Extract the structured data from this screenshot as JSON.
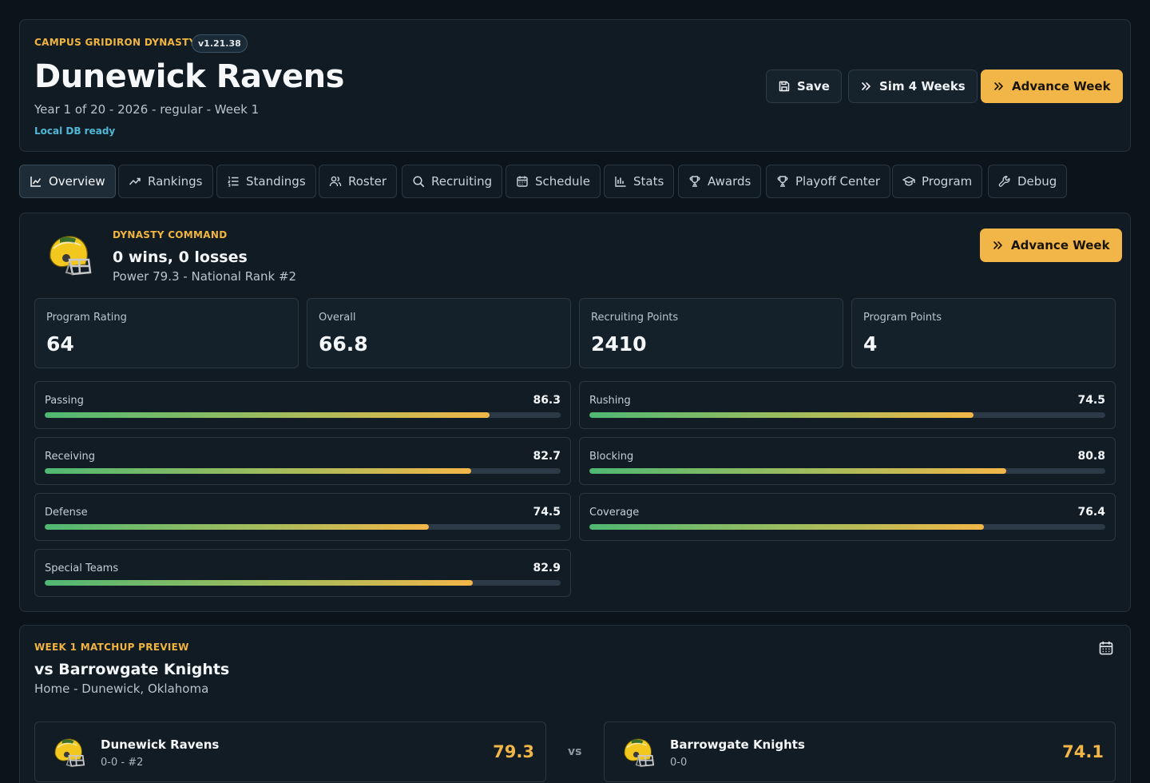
{
  "header": {
    "eyebrow": "CAMPUS GRIDIRON DYNASTY",
    "version": "v1.21.38",
    "title": "Dunewick Ravens",
    "subtitle": "Year 1 of 20 - 2026 - regular - Week 1",
    "db_status": "Local DB ready",
    "buttons": {
      "save": "Save",
      "sim": "Sim 4 Weeks",
      "advance": "Advance Week"
    }
  },
  "tabs": [
    {
      "label": "Overview",
      "icon": "chart-line-icon",
      "active": true
    },
    {
      "label": "Rankings",
      "icon": "trending-up-icon"
    },
    {
      "label": "Standings",
      "icon": "list-ordered-icon"
    },
    {
      "label": "Roster",
      "icon": "users-icon"
    },
    {
      "label": "Recruiting",
      "icon": "search-icon"
    },
    {
      "label": "Schedule",
      "icon": "calendar-icon"
    },
    {
      "label": "Stats",
      "icon": "bar-chart-icon"
    },
    {
      "label": "Awards",
      "icon": "trophy-icon"
    },
    {
      "label": "Playoff Center",
      "icon": "trophy-icon"
    },
    {
      "label": "Program",
      "icon": "graduation-cap-icon"
    },
    {
      "label": "Debug",
      "icon": "wrench-icon"
    }
  ],
  "command": {
    "eyebrow": "DYNASTY COMMAND",
    "record": "0 wins, 0 losses",
    "subtitle": "Power 79.3 - National Rank #2",
    "advance_label": "Advance Week",
    "stats": [
      {
        "label": "Program Rating",
        "value": "64"
      },
      {
        "label": "Overall",
        "value": "66.8"
      },
      {
        "label": "Recruiting Points",
        "value": "2410"
      },
      {
        "label": "Program Points",
        "value": "4"
      }
    ],
    "ratings": [
      {
        "label": "Passing",
        "value": "86.3",
        "pct": 86.3
      },
      {
        "label": "Rushing",
        "value": "74.5",
        "pct": 74.5
      },
      {
        "label": "Receiving",
        "value": "82.7",
        "pct": 82.7
      },
      {
        "label": "Blocking",
        "value": "80.8",
        "pct": 80.8
      },
      {
        "label": "Defense",
        "value": "74.5",
        "pct": 74.5
      },
      {
        "label": "Coverage",
        "value": "76.4",
        "pct": 76.4
      },
      {
        "label": "Special Teams",
        "value": "82.9",
        "pct": 82.9
      }
    ]
  },
  "matchup": {
    "eyebrow": "WEEK 1 MATCHUP PREVIEW",
    "title": "vs Barrowgate Knights",
    "subtitle": "Home - Dunewick, Oklahoma",
    "vs": "vs",
    "home": {
      "name": "Dunewick Ravens",
      "record": "0-0 - #2",
      "power": "79.3"
    },
    "away": {
      "name": "Barrowgate Knights",
      "record": "0-0",
      "power": "74.1"
    }
  },
  "colors": {
    "accent": "#f2b648",
    "background": "#0c141b",
    "panel": "#111b23",
    "bar_start": "#4fb873",
    "bar_end": "#f2b648",
    "status": "#4fb8d6"
  }
}
